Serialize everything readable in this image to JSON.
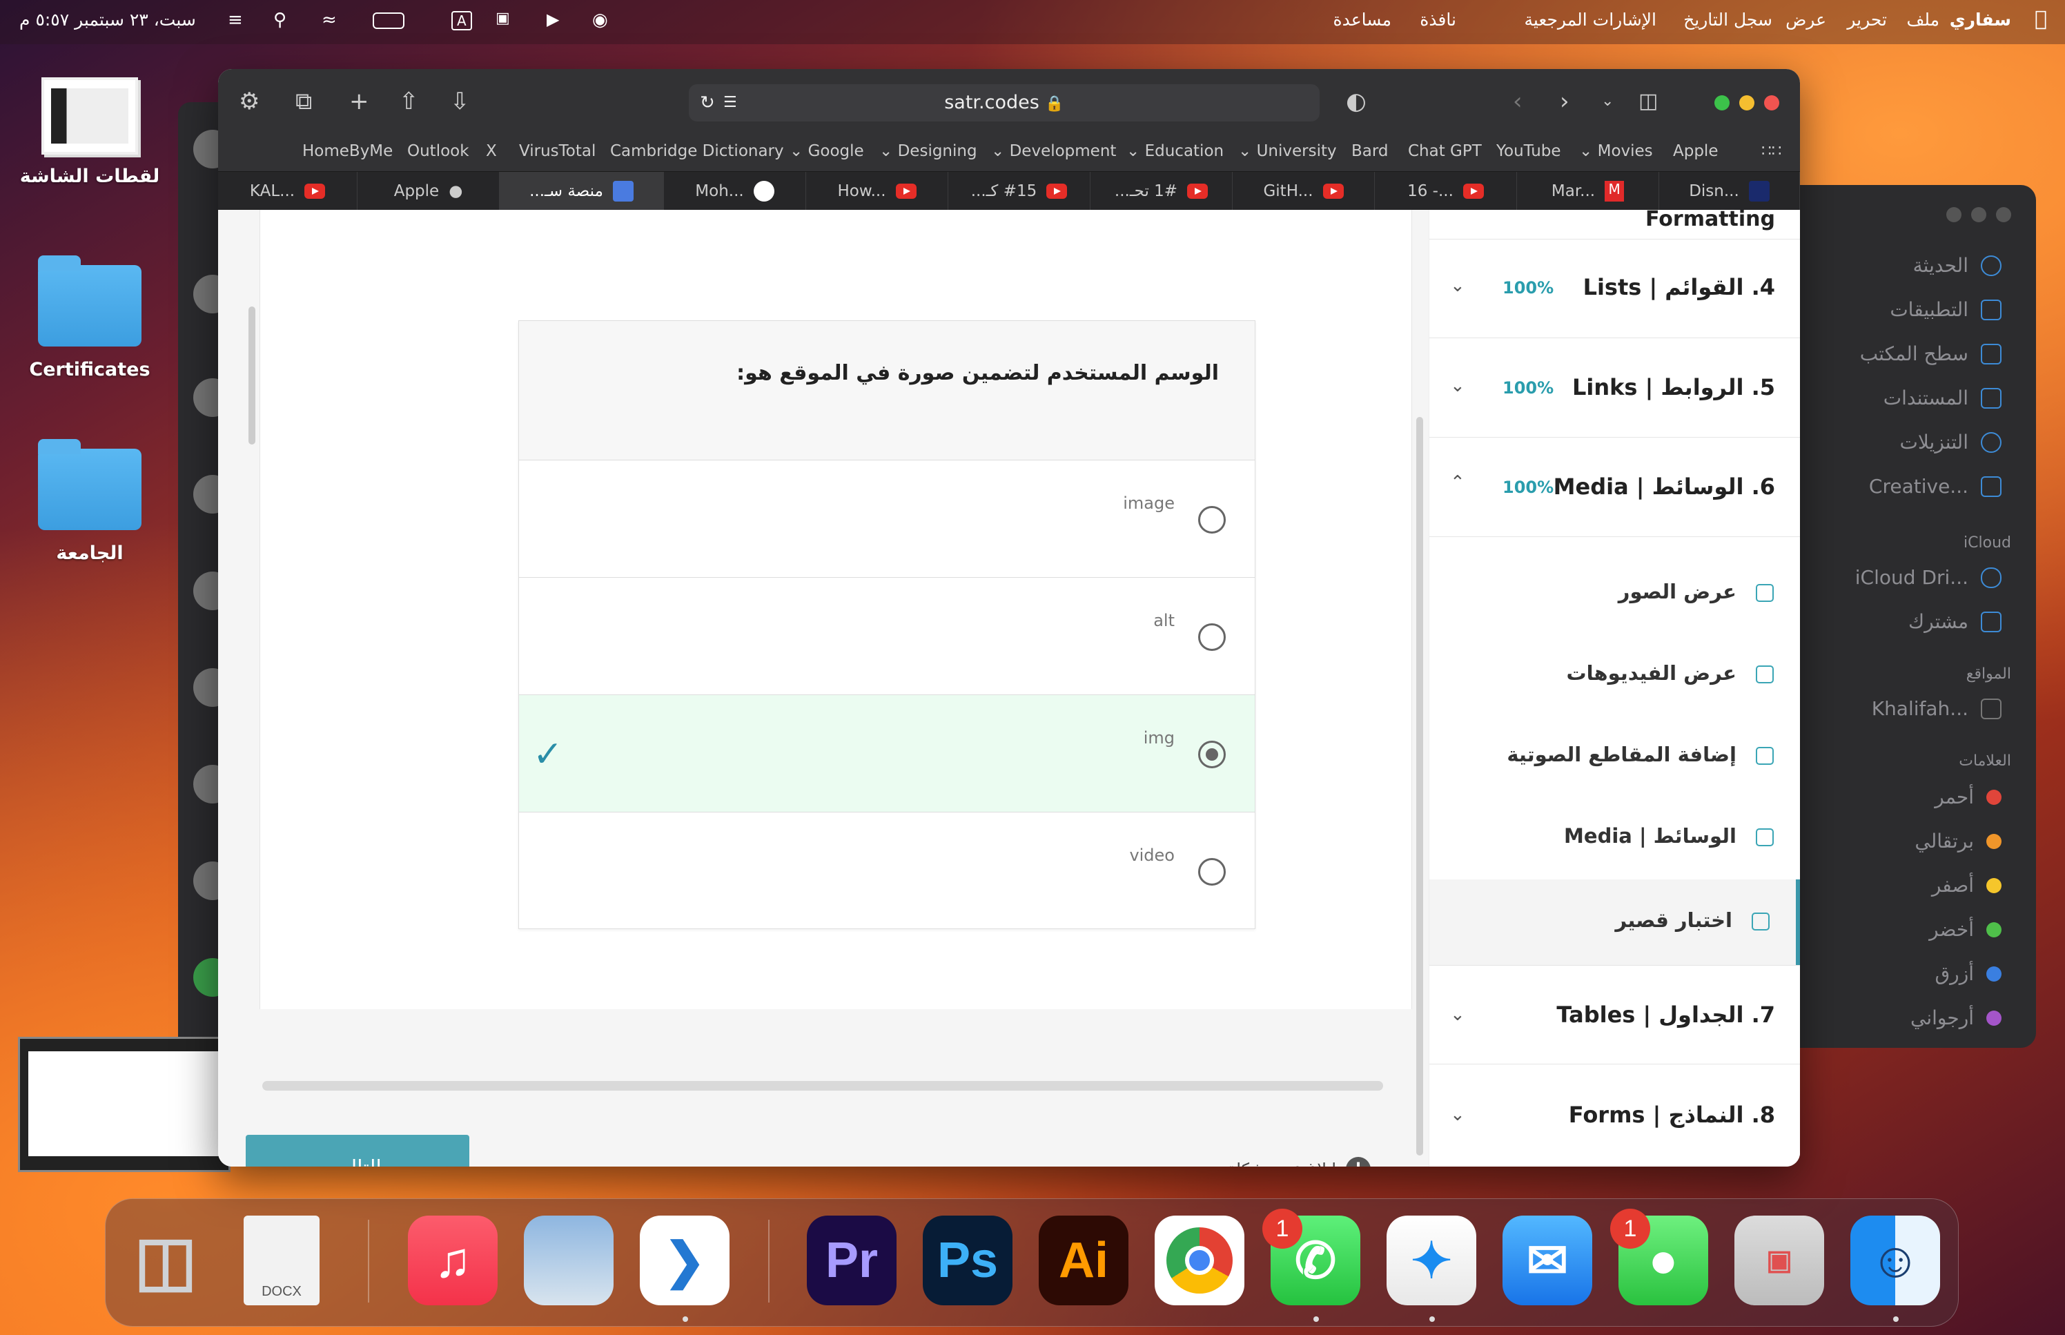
{
  "menubar": {
    "apple": "",
    "app": "سفاري",
    "items": [
      "ملف",
      "تحرير",
      "عرض",
      "سجل التاريخ",
      "الإشارات المرجعية",
      "نافذة",
      "مساعدة"
    ],
    "datetime": "سبت، ٢٣ سبتمبر ٥:٥٧ م",
    "input": "A"
  },
  "desktop": {
    "screenshots": "لقطات الشاشة",
    "certificates": "Certificates",
    "university": "الجامعة"
  },
  "finder": {
    "recents": "الحديثة",
    "applications": "التطبيقات",
    "desktop": "سطح المكتب",
    "documents": "المستندات",
    "downloads": "التنزيلات",
    "creative": "Creative...",
    "icloud_header": "iCloud",
    "icloud_drive": "iCloud Dri...",
    "shared": "مشترك",
    "locations_header": "المواقع",
    "location": "Khalifah...",
    "tags_header": "العلامات",
    "tags": [
      {
        "name": "أحمر",
        "color": "#e0453a"
      },
      {
        "name": "برتقالي",
        "color": "#f0962a"
      },
      {
        "name": "أصفر",
        "color": "#f5c62b"
      },
      {
        "name": "أخضر",
        "color": "#4fbf4a"
      },
      {
        "name": "أزرق",
        "color": "#3a7fe0"
      },
      {
        "name": "أرجواني",
        "color": "#a455c9"
      }
    ]
  },
  "browser": {
    "url": "satr.codes",
    "bookmarks": [
      "HomeByMe",
      "Outlook",
      "X",
      "VirusTotal",
      "Cambridge Dictionary",
      "Google",
      "Designing",
      "Development",
      "Education",
      "University",
      "Bard",
      "Chat GPT",
      "YouTube",
      "Movies",
      "Apple"
    ],
    "tabs": [
      "KAL...",
      "Apple",
      "منصة سـ...",
      "Moh...",
      "How...",
      "#15 كـ...",
      "1# تحـ...",
      "GitH...",
      "16 -...",
      "Mar...",
      "Disn..."
    ]
  },
  "quiz": {
    "question": "الوسم المستخدم لتضمين صورة في الموقع هو:",
    "options": [
      {
        "label": "image",
        "selected": false
      },
      {
        "label": "alt",
        "selected": false
      },
      {
        "label": "img",
        "selected": true
      },
      {
        "label": "video",
        "selected": false
      }
    ],
    "next_button": "التالي",
    "report": "ابلاغ عن مشكلة",
    "report_icon": "!"
  },
  "sidebar": {
    "prev_title": "Formatting",
    "sections": [
      {
        "title": "4. القوائم | Lists",
        "progress": "100%"
      },
      {
        "title": "5. الروابط | Links",
        "progress": "100%"
      },
      {
        "title": "6. الوسائط | Media",
        "progress": "100%"
      }
    ],
    "lessons": [
      "عرض الصور",
      "عرض الفيديوهات",
      "إضافة المقاطع الصوتية",
      "الوسائط | Media",
      "اختبار قصير"
    ],
    "later_sections": [
      {
        "title": "7. الجداول | Tables"
      },
      {
        "title": "8. النماذج | Forms"
      }
    ]
  },
  "dock": {
    "docx_label": "DOCX",
    "pr": "Pr",
    "ps": "Ps",
    "ai": "Ai",
    "whatsapp_badge": "1",
    "messages_badge": "1"
  }
}
